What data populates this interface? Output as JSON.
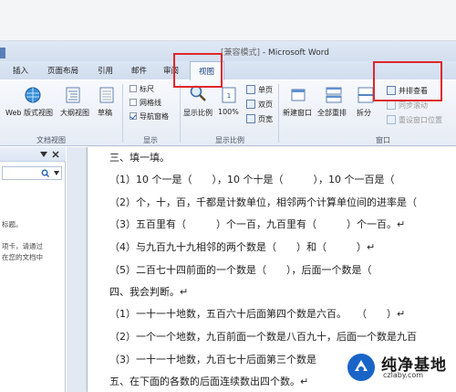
{
  "window": {
    "title": "Microsoft Word",
    "mode": "[兼容模式]",
    "separator": " - "
  },
  "ribbon_tabs": [
    "插入",
    "页面布局",
    "引用",
    "邮件",
    "审阅",
    "视图"
  ],
  "active_tab": "视图",
  "groups": {
    "doc_views": {
      "label": "文档视图",
      "buttons": [
        "Web 版式视图",
        "大纲视图",
        "草稿"
      ]
    },
    "show": {
      "label": "显示",
      "checks": [
        {
          "label": "标尺",
          "checked": false
        },
        {
          "label": "网格线",
          "checked": false
        },
        {
          "label": "导航窗格",
          "checked": true
        }
      ]
    },
    "zoom": {
      "label": "显示比例",
      "buttons": [
        "显示比例",
        "100%",
        "单页",
        "双页",
        "页宽"
      ]
    },
    "window": {
      "label": "窗口",
      "buttons": [
        "新建窗口",
        "全部重排",
        "拆分",
        "并排查看",
        "同步滚动",
        "重设窗口位置"
      ]
    }
  },
  "nav_pane": {
    "lines": [
      "标题。",
      "项卡，请通过",
      "在您的文档中"
    ]
  },
  "document": {
    "lines": [
      "三、填一填。",
      "（1）10 个一是（　　），10 个十是（　　　），10 个一百是（　　",
      "（2）个，十，百，千都是计数单位，相邻两个计算单位间的进率是（",
      "（3）五百里有（　　　）个一百，九百里有（　　　）个一百。↵",
      "（4）与九百九十九相邻的两个数是（　　）和（　　　）↵",
      "（5）二百七十四前面的一个数是（　　），后面一个数是（　　",
      "四、我会判断。↵",
      "（1）一十一十地数，五百六十后面第四个数是六百。　　（　　）↵",
      "（2）一个一个地数，九百前面一个数是八百九十，后面一个数是九百",
      "（3）一十一十地数，九百七十后面第三个数是",
      "五、在下面的各数的后面连续数出四个数。↵"
    ]
  },
  "logo": {
    "name": "纯净基地",
    "url": "czlaby.com"
  }
}
